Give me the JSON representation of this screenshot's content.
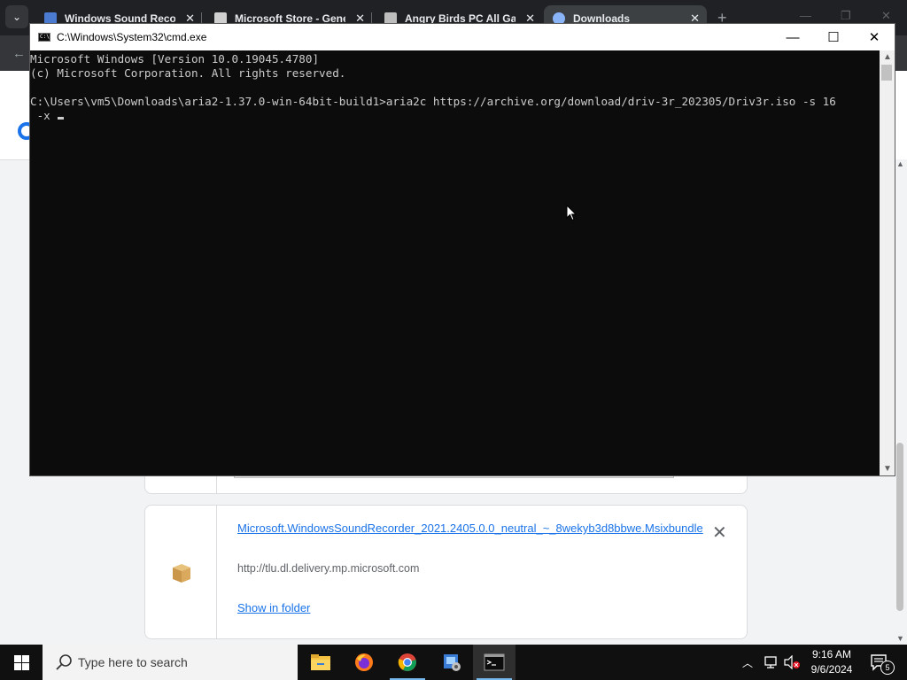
{
  "browser": {
    "tabs": [
      {
        "title": "Windows Sound Recorder",
        "close": "✕",
        "favicon_color": "#4a7bd1"
      },
      {
        "title": "Microsoft Store - Generation",
        "close": "✕",
        "favicon_color": "#d0d0d0"
      },
      {
        "title": "Angry Birds PC All Games",
        "close": "✕",
        "favicon_color": "#bdbdbd"
      },
      {
        "title": "Downloads",
        "close": "✕",
        "favicon_color": "#8ab4f8",
        "active": true
      }
    ],
    "new_tab": "+",
    "download_item": {
      "filename": "Microsoft.WindowsSoundRecorder_2021.2405.0.0_neutral_~_8wekyb3d8bbwe.Msixbundle",
      "url": "http://tlu.dl.delivery.mp.microsoft.com",
      "show_in_folder": "Show in folder",
      "remove": "✕"
    }
  },
  "cmd": {
    "title": "C:\\Windows\\System32\\cmd.exe",
    "lines": [
      "Microsoft Windows [Version 10.0.19045.4780]",
      "(c) Microsoft Corporation. All rights reserved.",
      "",
      "C:\\Users\\vm5\\Downloads\\aria2-1.37.0-win-64bit-build1>aria2c https://archive.org/download/driv-3r_202305/Driv3r.iso -s 16",
      " -x "
    ],
    "minimize": "—",
    "maximize": "☐",
    "close": "✕"
  },
  "taskbar": {
    "search_placeholder": "Type here to search",
    "apps": [
      "file-explorer",
      "firefox",
      "chrome",
      "settings",
      "command-prompt"
    ],
    "time": "9:16 AM",
    "date": "9/6/2024",
    "notification_count": "5"
  },
  "colors": {
    "console_bg": "#0c0c0c",
    "console_text": "#cccccc",
    "link": "#1a73e8",
    "taskbar": "#101010"
  }
}
